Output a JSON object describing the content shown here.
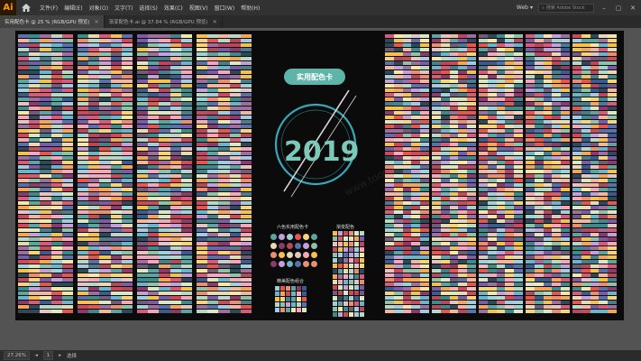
{
  "app": {
    "logo": "Ai"
  },
  "menu": [
    "文件(F)",
    "编辑(E)",
    "对象(O)",
    "文字(T)",
    "选择(S)",
    "效果(C)",
    "视图(V)",
    "窗口(W)",
    "帮助(H)"
  ],
  "workspace": {
    "label": "Web"
  },
  "search": {
    "placeholder": "搜索 Adobe Stock"
  },
  "tabs": [
    {
      "label": "实用配色卡 @ 25 % (RGB/GPU 预览)",
      "active": true
    },
    {
      "label": "渐变配色卡.ai @ 37.84 % (RGB/GPU 预览)",
      "active": false
    }
  ],
  "status": {
    "zoom": "27.26%",
    "page": "1",
    "mode": "选择"
  },
  "artwork": {
    "title": "实用配色卡",
    "year": "2019",
    "label_six": "六色实用配色卡",
    "label_grid": "渐变配色",
    "label_bottom": "精美配色组合"
  },
  "colors": {
    "artboard": "#0b0b0b",
    "accent_teal": "#5fb4a8",
    "accent_red": "#d9364f",
    "ai_orange": "#ff9a00"
  },
  "icons": {
    "home": "home-icon",
    "search": "search-icon",
    "close": "close-icon"
  }
}
